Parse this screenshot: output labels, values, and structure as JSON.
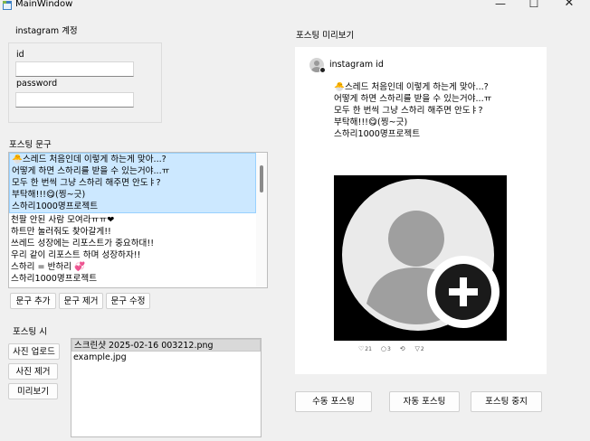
{
  "window": {
    "title": "MainWindow",
    "minimize_glyph": "—",
    "maximize_glyph": "☐",
    "close_glyph": "✕"
  },
  "account": {
    "group_title": "instagram 계정",
    "id_label": "id",
    "id_value": "",
    "password_label": "password",
    "password_value": ""
  },
  "posting_text": {
    "section_title": "포스팅 문구",
    "items": [
      {
        "lines": [
          "🐣스레드 처음인데 이렇게 하는게 맞아...?",
          "어떻게 하면 스하리를 받을 수 있는거야...ㅠ",
          "모두 한 번씩 그냥 스하리 해주면 안도ㅑ?",
          "부탁해!!!😋(찡~긋)",
          "스하리1000명프로젝트"
        ],
        "selected": true
      },
      {
        "lines": [
          "천팔 안된 사람 모여라ㅠㅠ❤",
          "하트만 눌러줘도 찾아갈게!!",
          "쓰레드 성장에는 리포스트가 중요하대!!",
          "우리 같이 리포스트 하며 성장하자!!",
          "스하리 = 반하리 💞",
          "스하리1000명프로젝트"
        ],
        "selected": false
      }
    ],
    "buttons": {
      "add": "문구 추가",
      "remove": "문구 제거",
      "edit": "문구 수정"
    }
  },
  "posting_media": {
    "section_title": "포스팅 시",
    "buttons": {
      "upload": "사진 업로드",
      "remove": "사진 제거",
      "preview": "미리보기"
    },
    "files": [
      {
        "name": "스크린샷 2025-02-16 003212.png",
        "selected": true
      },
      {
        "name": "example.jpg",
        "selected": false
      }
    ]
  },
  "preview": {
    "section_title": "포스팅 미리보기",
    "account_id": "instagram id",
    "caption_lines": [
      "🐣스레드 처음인데 이렇게 하는게 맞아...?",
      "어떻게 하면 스하리를 받을 수 있는거야...ㅠ",
      "모두 한 번씩 그냥 스하리 해주면 안도ㅑ?",
      "부탁해!!!😋(찡~긋)",
      "스하리1000명프로젝트"
    ],
    "reactions": [
      {
        "icon": "heart-icon",
        "glyph": "♡",
        "count": "21"
      },
      {
        "icon": "comment-icon",
        "glyph": "○",
        "count": "3"
      },
      {
        "icon": "repost-icon",
        "glyph": "⟲",
        "count": ""
      },
      {
        "icon": "send-icon",
        "glyph": "▽",
        "count": "2"
      }
    ]
  },
  "actions": {
    "manual": "수동 포스팅",
    "auto": "자동 포스팅",
    "stop": "포스팅 중지"
  },
  "colors": {
    "selection": "#cce8ff",
    "selection_border": "#99d1ff",
    "window_bg": "#f0f0f0"
  }
}
